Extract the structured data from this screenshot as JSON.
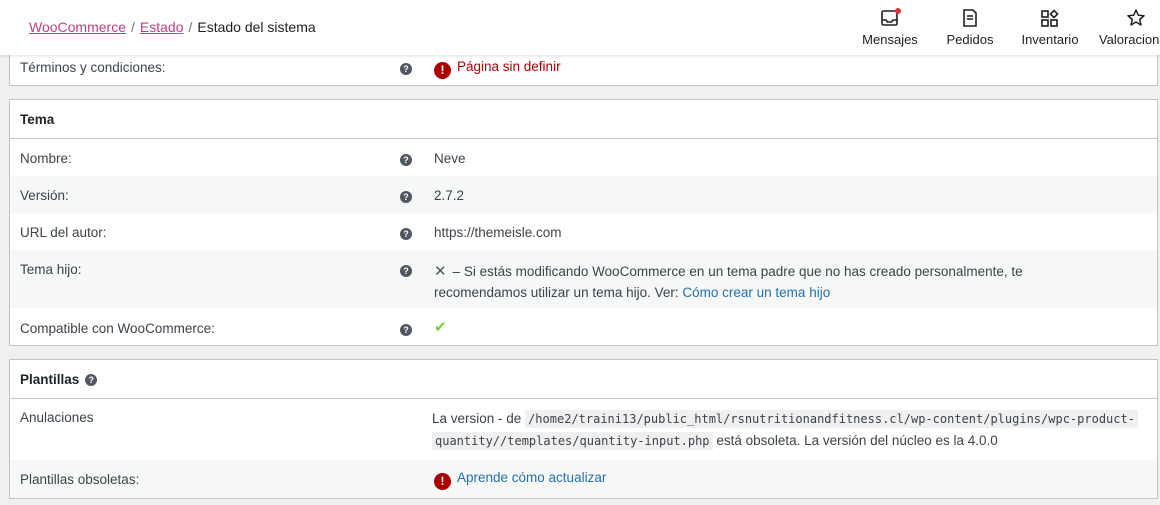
{
  "breadcrumb": {
    "woocommerce": "WooCommerce",
    "estado": "Estado",
    "current": "Estado del sistema",
    "separator": "/"
  },
  "activity_bar": {
    "mensajes": "Mensajes",
    "pedidos": "Pedidos",
    "inventario": "Inventario",
    "valoraciones": "Valoraciones"
  },
  "top_row": {
    "label": "Términos y condiciones:",
    "value": "Página sin definir"
  },
  "tema": {
    "title": "Tema",
    "rows": [
      {
        "label": "Nombre:",
        "value": "Neve"
      },
      {
        "label": "Versión:",
        "value": "2.7.2"
      },
      {
        "label": "URL del autor:",
        "value": "https://themeisle.com"
      },
      {
        "label": "Tema hijo:",
        "value_line1": "– Si estás modificando WooCommerce en un tema padre que no has creado personalmente, te",
        "value_line2": "recomendamos utilizar un tema hijo. Ver:",
        "link": "Cómo crear un tema hijo"
      },
      {
        "label": "Compatible con WooCommerce:",
        "value": "✔"
      }
    ]
  },
  "plantillas": {
    "title": "Plantillas",
    "anulaciones": {
      "label": "Anulaciones",
      "prefix": "La version - de",
      "path_line1": "/home2/traini13/public_html/rsnutritionandfitness.cl/wp-content/plugins/wpc-product-",
      "path_line2": "quantity//templates/quantity-input.php",
      "suffix": "está obsoleta. La versión del núcleo es la 4.0.0"
    },
    "obsoletas": {
      "label": "Plantillas obsoletas:",
      "link": "Aprende cómo actualizar"
    }
  },
  "colors": {
    "brand_link": "#bc3f83",
    "error": "#aa0000",
    "link": "#2271b1",
    "check": "#7ad03a"
  }
}
